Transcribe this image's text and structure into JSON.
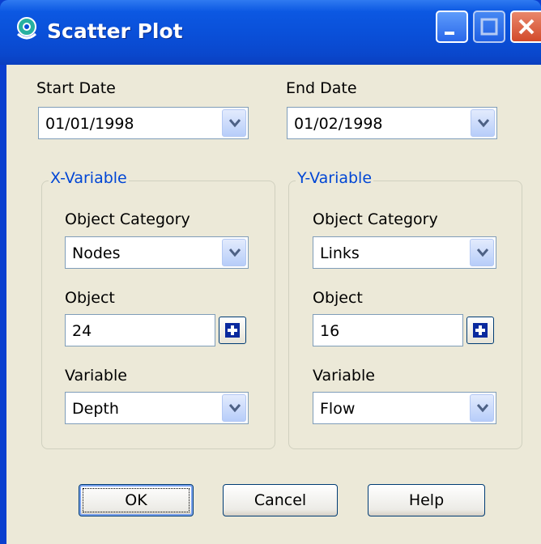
{
  "window": {
    "title": "Scatter Plot"
  },
  "dates": {
    "start_label": "Start Date",
    "start_value": "01/01/1998",
    "end_label": "End Date",
    "end_value": "01/02/1998"
  },
  "x_variable": {
    "legend": "X-Variable",
    "category_label": "Object Category",
    "category_value": "Nodes",
    "object_label": "Object",
    "object_value": "24",
    "variable_label": "Variable",
    "variable_value": "Depth"
  },
  "y_variable": {
    "legend": "Y-Variable",
    "category_label": "Object Category",
    "category_value": "Links",
    "object_label": "Object",
    "object_value": "16",
    "variable_label": "Variable",
    "variable_value": "Flow"
  },
  "buttons": {
    "ok": "OK",
    "cancel": "Cancel",
    "help": "Help"
  },
  "icons": {
    "app": "lifebuoy-icon",
    "minimize": "minimize-icon",
    "maximize": "maximize-icon",
    "close": "close-icon",
    "dropdown": "chevron-down-icon",
    "add": "plus-icon"
  },
  "colors": {
    "title_bar": "#0a4fd8",
    "dialog_bg": "#ece9d8",
    "legend_text": "#0046d5"
  }
}
